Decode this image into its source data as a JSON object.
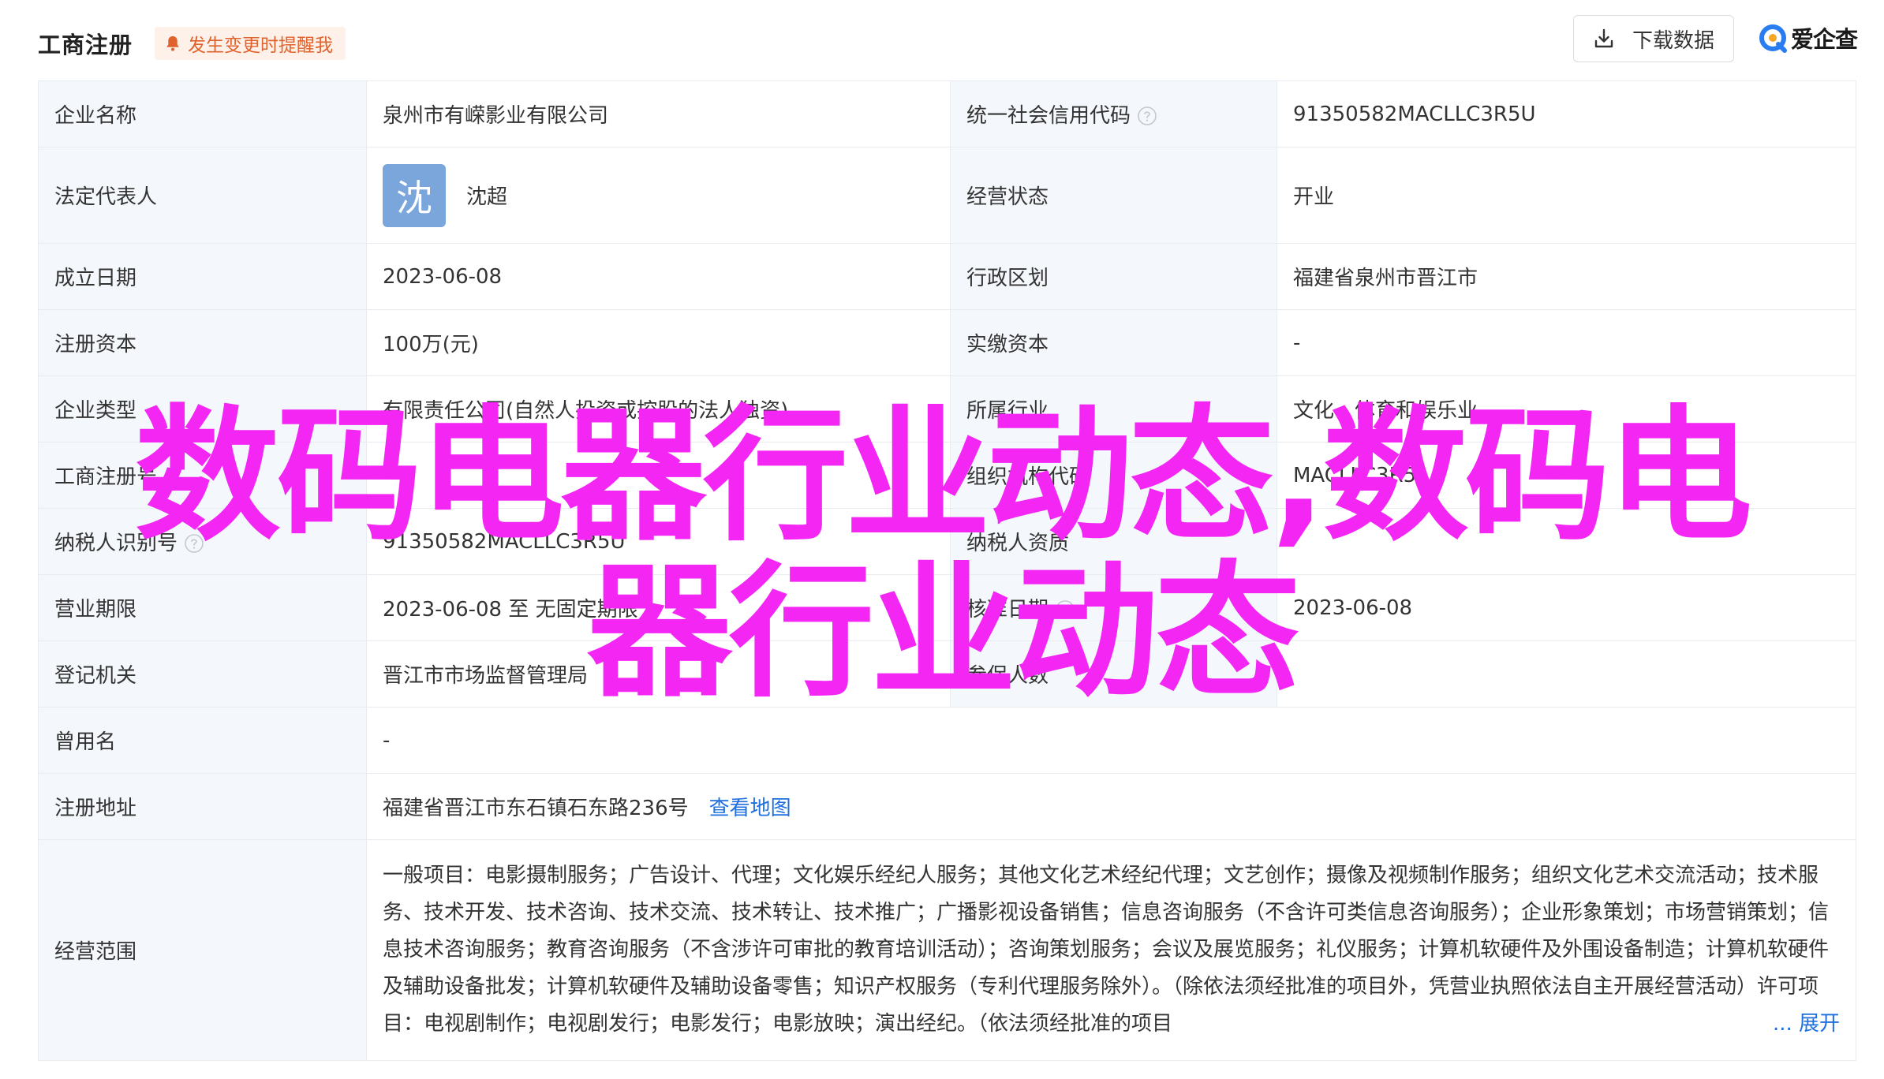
{
  "header": {
    "title": "工商注册",
    "alert_label": "发生变更时提醒我",
    "download_label": "下载数据",
    "brand_name": "爱企查"
  },
  "colors": {
    "accent_blue": "#1f6fde",
    "alert_orange": "#e0622c",
    "overlay_magenta": "#f426f4",
    "label_bg": "#f4f7fb",
    "avatar_bg": "#7aa6dc"
  },
  "rows": {
    "company_name": {
      "label": "企业名称",
      "value": "泉州市有嵘影业有限公司"
    },
    "credit_code": {
      "label": "统一社会信用代码",
      "value": "91350582MACLLC3R5U"
    },
    "legal_rep": {
      "label": "法定代表人",
      "avatar_char": "沈",
      "value": "沈超"
    },
    "status": {
      "label": "经营状态",
      "value": "开业"
    },
    "founded": {
      "label": "成立日期",
      "value": "2023-06-08"
    },
    "region": {
      "label": "行政区划",
      "value": "福建省泉州市晋江市"
    },
    "reg_capital": {
      "label": "注册资本",
      "value": "100万(元)"
    },
    "paid_capital": {
      "label": "实缴资本",
      "value": "-"
    },
    "company_type": {
      "label": "企业类型",
      "value": "有限责任公司(自然人投资或控股的法人独资)"
    },
    "industry": {
      "label": "所属行业",
      "value": "文化、体育和娱乐业"
    },
    "biz_reg_no": {
      "label": "工商注册号",
      "value": ""
    },
    "org_code": {
      "label": "组织机构代码",
      "value": "MACLLC3R5"
    },
    "taxpayer_id": {
      "label": "纳税人识别号",
      "value": "91350582MACLLC3R5U"
    },
    "taxpayer_qual": {
      "label": "纳税人资质",
      "value": ""
    },
    "term": {
      "label": "营业期限",
      "value": "2023-06-08 至 无固定期限"
    },
    "approval_date": {
      "label": "核准日期",
      "value": "2023-06-08"
    },
    "authority": {
      "label": "登记机关",
      "value": "晋江市市场监督管理局"
    },
    "insured": {
      "label": "参保人数",
      "value": ""
    },
    "former_name": {
      "label": "曾用名",
      "value": "-"
    },
    "address": {
      "label": "注册地址",
      "value": "福建省晋江市东石镇石东路236号",
      "map_link": "查看地图"
    },
    "scope": {
      "label": "经营范围",
      "value": "一般项目：电影摄制服务；广告设计、代理；文化娱乐经纪人服务；其他文化艺术经纪代理；文艺创作；摄像及视频制作服务；组织文化艺术交流活动；技术服务、技术开发、技术咨询、技术交流、技术转让、技术推广；广播影视设备销售；信息咨询服务（不含许可类信息咨询服务）；企业形象策划；市场营销策划；信息技术咨询服务；教育咨询服务（不含涉许可审批的教育培训活动）；咨询策划服务；会议及展览服务；礼仪服务；计算机软硬件及外围设备制造；计算机软硬件及辅助设备批发；计算机软硬件及辅助设备零售；知识产权服务（专利代理服务除外）。（除依法须经批准的项目外，凭营业执照依法自主开展经营活动）许可项目：电视剧制作；电视剧发行；电影发行；电影放映；演出经纪。（依法须经批准的项目",
      "expand_label": "... 展开"
    }
  },
  "overlay": {
    "line1": "数码电器行业动态,数码电",
    "line2": "器行业动态"
  }
}
